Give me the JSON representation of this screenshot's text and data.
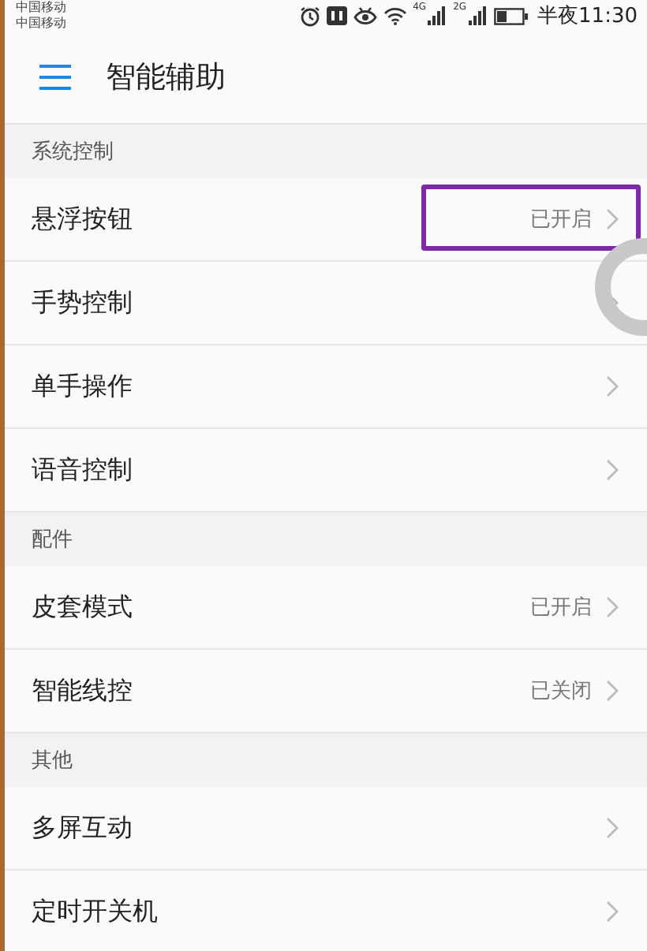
{
  "status_bar": {
    "carriers": [
      "中国移动",
      "中国移动"
    ],
    "network_1": "4G",
    "network_2": "2G",
    "time": "半夜11:30"
  },
  "header": {
    "title": "智能辅助"
  },
  "sections": [
    {
      "title": "系统控制",
      "items": [
        {
          "label": "悬浮按钮",
          "value": "已开启",
          "highlighted": true
        },
        {
          "label": "手势控制",
          "highlighted": false
        },
        {
          "label": "单手操作",
          "highlighted": false
        },
        {
          "label": "语音控制",
          "highlighted": false
        }
      ]
    },
    {
      "title": "配件",
      "items": [
        {
          "label": "皮套模式",
          "value": "已开启",
          "highlighted": false
        },
        {
          "label": "智能线控",
          "value": "已关闭",
          "highlighted": false
        }
      ]
    },
    {
      "title": "其他",
      "items": [
        {
          "label": "多屏互动",
          "highlighted": false
        },
        {
          "label": "定时开关机",
          "highlighted": false
        }
      ]
    }
  ],
  "floating_button": {
    "on": true
  }
}
